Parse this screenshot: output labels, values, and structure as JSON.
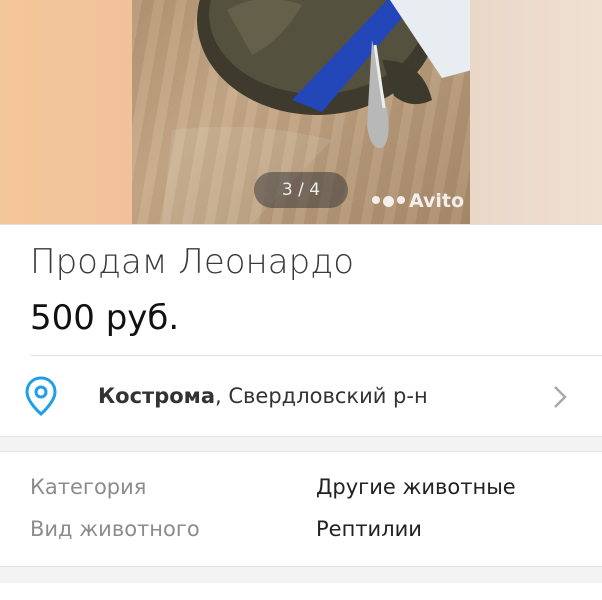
{
  "gallery": {
    "counter": "3 / 4",
    "watermark": "Avito"
  },
  "listing": {
    "title": "Продам Леонардо",
    "price": "500 руб."
  },
  "location": {
    "city": "Кострома",
    "separator": ",",
    "district": " Свердловский р-н",
    "pin_icon": "location-pin-icon",
    "chevron_icon": "chevron-right-icon",
    "accent_color": "#1ea0e6"
  },
  "params": [
    {
      "name": "Категория",
      "value": "Другие животные"
    },
    {
      "name": "Вид животного",
      "value": "Рептилии"
    }
  ]
}
